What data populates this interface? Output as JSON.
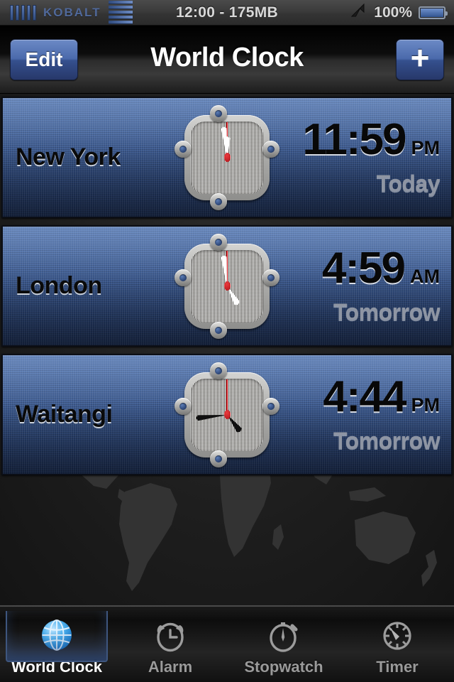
{
  "status_bar": {
    "signal_icon": "signal-bars-icon",
    "carrier": "KOBALT",
    "network_icon": "network-bars-icon",
    "center_text": "12:00 - 175MB",
    "location_icon": "location-arrow-icon",
    "battery_percent": "100%",
    "battery_icon": "battery-icon",
    "battery_level": 100
  },
  "nav_bar": {
    "edit_label": "Edit",
    "title": "World Clock",
    "add_label": "+"
  },
  "colors": {
    "accent_blue": "#4a69ab",
    "row_blue_top": "#5a7cb4",
    "row_blue_bottom": "#16233d",
    "second_hand_red": "#cc1b20",
    "active_tab_blue": "#3e567f"
  },
  "clocks": [
    {
      "city": "New York",
      "time": "11:59",
      "ampm": "PM",
      "day": "Today",
      "hand_style": "white",
      "hour_deg": 359,
      "minute_deg": 354,
      "second_deg": 0
    },
    {
      "city": "London",
      "time": "4:59",
      "ampm": "AM",
      "day": "Tomorrow",
      "hand_style": "white",
      "hour_deg": 150,
      "minute_deg": 354,
      "second_deg": 0
    },
    {
      "city": "Waitangi",
      "time": "4:44",
      "ampm": "PM",
      "day": "Tomorrow",
      "hand_style": "black",
      "hour_deg": 142,
      "minute_deg": 264,
      "second_deg": 0
    }
  ],
  "tabs": [
    {
      "label": "World Clock",
      "icon": "globe-icon",
      "active": true
    },
    {
      "label": "Alarm",
      "icon": "alarm-clock-icon",
      "active": false
    },
    {
      "label": "Stopwatch",
      "icon": "stopwatch-icon",
      "active": false
    },
    {
      "label": "Timer",
      "icon": "timer-gauge-icon",
      "active": false
    }
  ],
  "background": {
    "map_description": "world-map-silhouette"
  }
}
